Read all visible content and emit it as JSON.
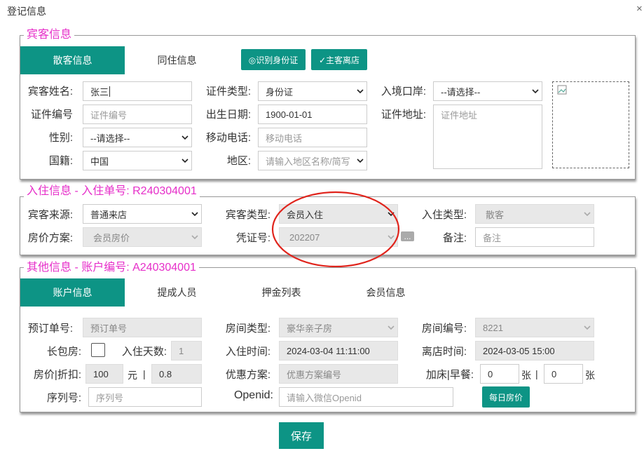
{
  "dialog": {
    "title": "登记信息",
    "close": "×"
  },
  "guest": {
    "legend": "宾客信息",
    "tabs": [
      "散客信息",
      "同住信息"
    ],
    "buttons": {
      "id_scan": "◎识别身份证",
      "checkout": "✓主客离店"
    },
    "labels": {
      "name": "宾客姓名:",
      "id_type": "证件类型:",
      "entry_port": "入境口岸:",
      "id_no": "证件编号",
      "birth": "出生日期:",
      "id_addr": "证件地址:",
      "gender": "性别:",
      "mobile": "移动电话:",
      "nation": "国籍:",
      "region": "地区:"
    },
    "values": {
      "name": "张三",
      "id_type": "身份证",
      "entry_port": "--请选择--",
      "id_no_ph": "证件编号",
      "birth": "1900-01-01",
      "id_addr_ph": "证件地址",
      "gender": "--请选择--",
      "mobile_ph": "移动电话",
      "nation": "中国",
      "region_ph": "请输入地区名称/简写"
    }
  },
  "checkin": {
    "legend": "入住信息 - 入住单号: R240304001",
    "labels": {
      "source": "宾客来源:",
      "guest_type": "宾客类型:",
      "stay_type": "入住类型:",
      "price_plan": "房价方案:",
      "voucher": "凭证号:",
      "remark": "备注:"
    },
    "values": {
      "source": "普通来店",
      "guest_type": "会员入住",
      "stay_type": "散客",
      "price_plan": "会员房价",
      "voucher": "202207",
      "ellipsis": "...",
      "remark_ph": "备注"
    }
  },
  "other": {
    "legend": "其他信息 - 账户编号: A240304001",
    "tabs": [
      "账户信息",
      "提成人员",
      "押金列表",
      "会员信息"
    ],
    "labels": {
      "booking_no": "预订单号:",
      "room_type": "房间类型:",
      "room_no": "房间编号:",
      "long_stay": "长包房:",
      "days": "入住天数:",
      "checkin_time": "入住时间:",
      "checkout_time": "离店时间:",
      "price_discount": "房价|折扣:",
      "promo": "优惠方案:",
      "extra": "加床|早餐:",
      "serial": "序列号:",
      "openid": "Openid:"
    },
    "values": {
      "booking_no_ph": "预订单号",
      "room_type": "豪华亲子房",
      "room_no": "8221",
      "days": "1",
      "checkin_time": "2024-03-04 11:11:00",
      "checkout_time": "2024-03-05 15:00",
      "price": "100",
      "yuan": "元",
      "sep": "|",
      "discount": "0.8",
      "promo_ph": "优惠方案编号",
      "extra_bed": "0",
      "zhang": "张",
      "breakfast": "0",
      "serial_ph": "序列号",
      "openid_ph": "请输入微信Openid",
      "daily_price": "每日房价"
    }
  },
  "actions": {
    "save": "保存"
  },
  "colors": {
    "accent": "#0d9485",
    "legend": "#e62ec9",
    "annotation": "#e0241c"
  }
}
